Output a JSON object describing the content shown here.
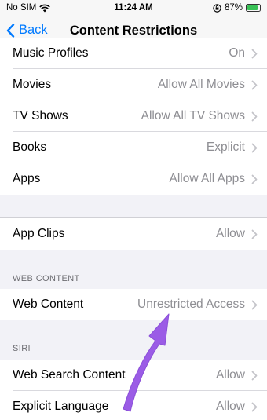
{
  "status": {
    "carrier": "No SIM",
    "time": "11:24 AM",
    "battery": "87%",
    "battery_level": 0.87
  },
  "nav": {
    "back_label": "Back",
    "title": "Content Restrictions"
  },
  "rows": {
    "music": {
      "label": "Music Profiles",
      "value": "On"
    },
    "movies": {
      "label": "Movies",
      "value": "Allow All Movies"
    },
    "tv": {
      "label": "TV Shows",
      "value": "Allow All TV Shows"
    },
    "books": {
      "label": "Books",
      "value": "Explicit"
    },
    "apps": {
      "label": "Apps",
      "value": "Allow All Apps"
    },
    "app_clips": {
      "label": "App Clips",
      "value": "Allow"
    },
    "web_content": {
      "label": "Web Content",
      "value": "Unrestricted Access"
    },
    "web_search": {
      "label": "Web Search Content",
      "value": "Allow"
    },
    "explicit_language": {
      "label": "Explicit Language",
      "value": "Allow"
    }
  },
  "sections": {
    "web_content": "WEB CONTENT",
    "siri": "SIRI"
  },
  "colors": {
    "accent": "#007aff",
    "annotation_arrow": "#9b5ce6"
  }
}
